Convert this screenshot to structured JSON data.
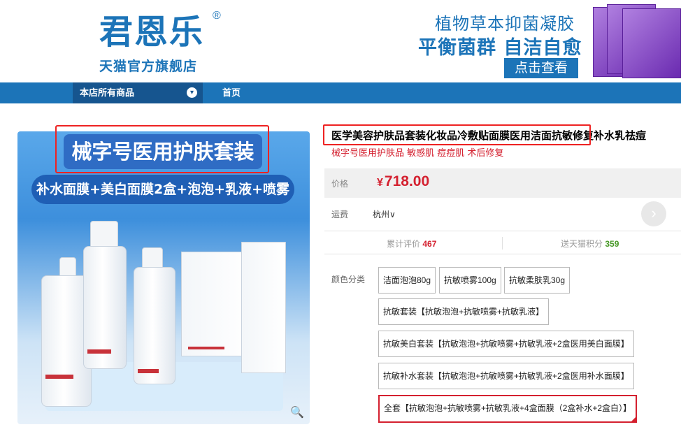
{
  "header": {
    "logo_main": "君恩乐",
    "logo_reg": "®",
    "logo_sub": "天猫官方旗舰店",
    "banner_line1": "植物草本抑菌凝胶",
    "banner_line2": "平衡菌群 自洁自愈",
    "banner_button": "点击查看"
  },
  "nav": {
    "all_products": "本店所有商品",
    "chevron": "▾",
    "home": "首页"
  },
  "product_image": {
    "title": "械字号医用护肤套装",
    "subtitle": "补水面膜+美白面膜2盒+泡泡+乳液+喷雾",
    "zoom_icon": "🔍"
  },
  "detail": {
    "title": "医学美容护肤品套装化妆品冷敷贴面膜医用洁面抗敏修复补水乳祛痘",
    "subtitle": "械字号医用护肤品 敏感肌 痘痘肌 术后修复",
    "price_label": "价格",
    "price_currency": "¥",
    "price_value": "718.00",
    "ship_label": "运费",
    "ship_value": "杭州",
    "ship_chevron": "∨",
    "next_icon": "›",
    "reviews_label": "累计评价",
    "reviews_count": "467",
    "points_label": "送天猫积分",
    "points_count": "359",
    "color_label": "颜色分类",
    "options": [
      "洁面泡泡80g",
      "抗敏喷雾100g",
      "抗敏柔肤乳30g",
      "抗敏套装【抗敏泡泡+抗敏喷雾+抗敏乳液】",
      "抗敏美白套装【抗敏泡泡+抗敏喷雾+抗敏乳液+2盒医用美白面膜】",
      "抗敏补水套装【抗敏泡泡+抗敏喷雾+抗敏乳液+2盒医用补水面膜】",
      "全套【抗敏泡泡+抗敏喷雾+抗敏乳液+4盒面膜（2盒补水+2盒白）】"
    ]
  },
  "colors": {
    "brand_blue": "#1c74b8",
    "price_red": "#d4202f",
    "highlight_red": "#e22222"
  }
}
